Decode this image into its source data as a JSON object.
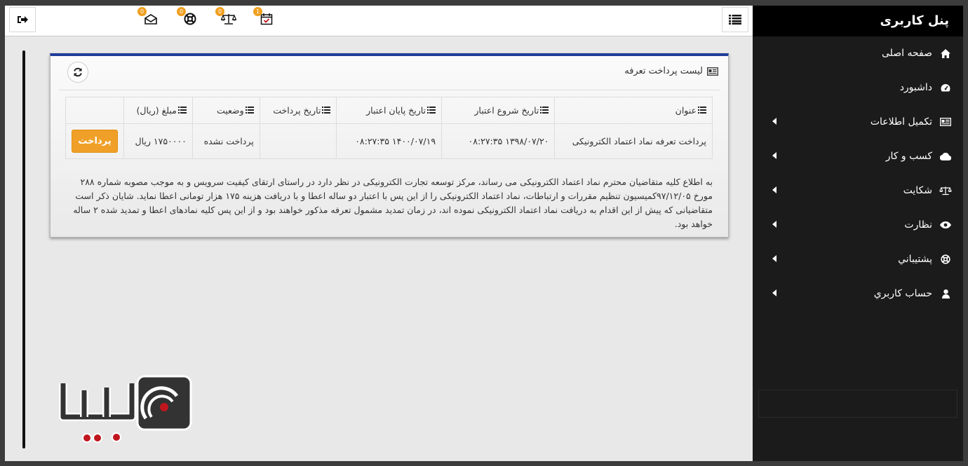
{
  "sidebar": {
    "title": "پنل کاربری",
    "items": [
      {
        "label": "صفحه اصلی",
        "icon": "home-icon",
        "expandable": false
      },
      {
        "label": "داشبورد",
        "icon": "dashboard-icon",
        "expandable": false
      },
      {
        "label": "تکمیل اطلاعات",
        "icon": "id-card-icon",
        "expandable": true
      },
      {
        "label": "کسب و کار",
        "icon": "cloud-icon",
        "expandable": true
      },
      {
        "label": "شکایت",
        "icon": "scale-icon",
        "expandable": true
      },
      {
        "label": "نظارت",
        "icon": "eye-icon",
        "expandable": true
      },
      {
        "label": "پشتيباني",
        "icon": "lifebuoy-icon",
        "expandable": true
      },
      {
        "label": "حساب كاربري",
        "icon": "user-icon",
        "expandable": true
      }
    ]
  },
  "topbar": {
    "notifications": [
      {
        "icon": "envelope-icon",
        "count": "0"
      },
      {
        "icon": "lifebuoy-icon",
        "count": "0"
      },
      {
        "icon": "scale-icon",
        "count": "0"
      },
      {
        "icon": "calendar-check-icon",
        "count": "1"
      }
    ]
  },
  "card": {
    "title": "لیست پرداخت تعرفه",
    "columns": [
      "عنوان",
      "تاریخ شروع اعتبار",
      "تاریخ پایان اعتبار",
      "تاریخ پرداخت",
      "وضعیت",
      "مبلغ (ریال)"
    ],
    "rows": [
      {
        "title": "پرداخت تعرفه نماد اعتماد الکترونیکی",
        "start": "۱۳۹۸/۰۷/۲۰ ۰۸:۲۷:۳۵",
        "end": "۱۴۰۰/۰۷/۱۹ ۰۸:۲۷:۳۵",
        "paid_date": "",
        "status": "پرداخت نشده",
        "amount": "۱۷۵۰۰۰۰ ریال",
        "action": "پرداخت"
      }
    ],
    "notice": "به اطلاع کلیه متقاضیان محترم نماد اعتماد الکترونیکی می رساند، مرکز توسعه تجارت الکترونیکی در نظر دارد در راستای ارتقای کیفیت سرویس و به موجب مصوبه شماره ۲۸۸ مورخ ۹۷/۱۲/۰۵کمیسیون تنظیم مقررات و ارتباطات، نماد اعتماد الکترونیکی را از این پس با اعتبار دو ساله اعطا و با دریافت هزینه ۱۷۵ هزار تومانی اعطا نماید. شایان ذکر است متقاضیانی که پیش از این اقدام به دریافت نماد اعتماد الکترونیکی نموده اند، در زمان تمدید مشمول تعرفه مذکور خواهند بود و از این پس کلیه نمادهای اعطا و تمدید شده ۲ ساله خواهد بود."
  },
  "colors": {
    "sidebar_bg": "#1b1b1b",
    "sidebar_header_bg": "#000000",
    "card_top_border": "#1f3d99",
    "pay_button": "#f0a028",
    "badge": "#f0a020",
    "logo_red": "#c0161e"
  }
}
